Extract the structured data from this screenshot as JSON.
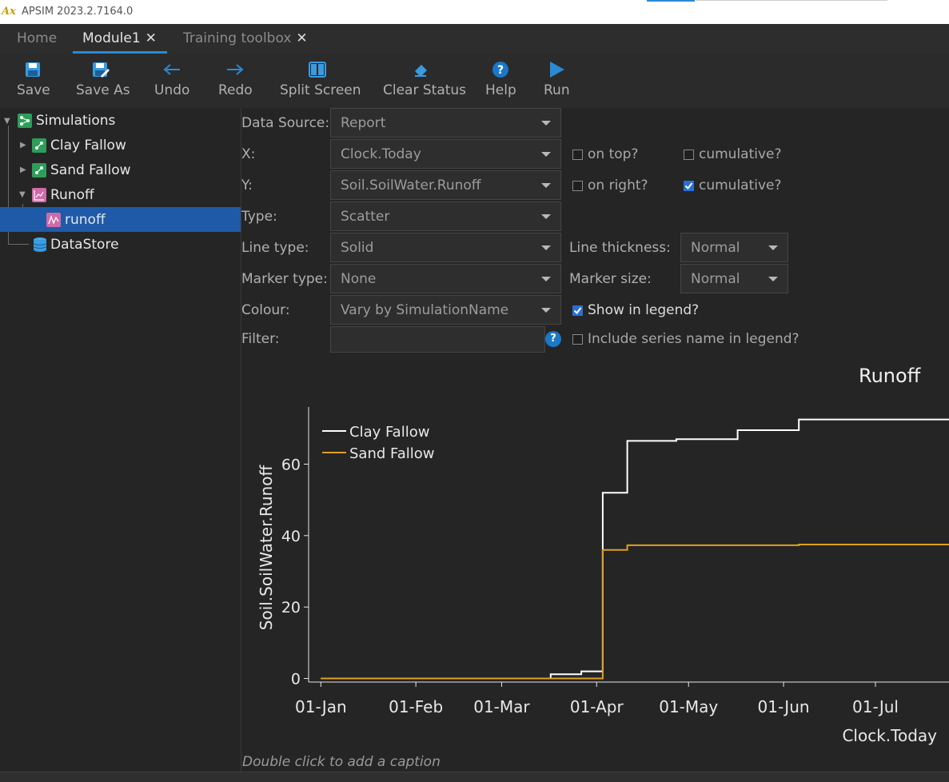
{
  "app": {
    "title": "APSIM 2023.2.7164.0",
    "logo_letter": "A",
    "logo_sub": "x"
  },
  "tabs": [
    {
      "label": "Home"
    },
    {
      "label": "Module1",
      "active": true
    },
    {
      "label": "Training toolbox"
    }
  ],
  "tab_close_glyph": "✕",
  "toolbar": [
    {
      "label": "Save",
      "icon": "save-icon"
    },
    {
      "label": "Save As",
      "icon": "save-as-icon"
    },
    {
      "label": "Undo",
      "icon": "undo-arrow-icon"
    },
    {
      "label": "Redo",
      "icon": "redo-arrow-icon"
    },
    {
      "label": "Split Screen",
      "icon": "split-screen-icon"
    },
    {
      "label": "Clear Status",
      "icon": "eraser-icon"
    },
    {
      "label": "Help",
      "icon": "help-icon"
    },
    {
      "label": "Run",
      "icon": "run-play-icon"
    }
  ],
  "tree": [
    {
      "label": "Simulations",
      "icon": "simulations-icon",
      "expanded": true
    },
    {
      "label": "Clay Fallow",
      "icon": "simulation-icon",
      "expanded": false
    },
    {
      "label": "Sand Fallow",
      "icon": "simulation-icon",
      "expanded": false
    },
    {
      "label": "Runoff",
      "icon": "graph-icon",
      "expanded": true
    },
    {
      "label": "runoff",
      "icon": "series-icon",
      "selected": true
    },
    {
      "label": "DataStore",
      "icon": "datastore-icon"
    }
  ],
  "form": {
    "data_source_label": "Data Source:",
    "data_source": "Report",
    "x_label": "X:",
    "x_value": "Clock.Today",
    "y_label": "Y:",
    "y_value": "Soil.SoilWater.Runoff",
    "type_label": "Type:",
    "type_value": "Scatter",
    "line_type_label": "Line type:",
    "line_type": "Solid",
    "marker_type_label": "Marker type:",
    "marker_type": "None",
    "colour_label": "Colour:",
    "colour": "Vary by SimulationName",
    "filter_label": "Filter:",
    "filter_value": "",
    "line_thickness_label": "Line thickness:",
    "line_thickness": "Normal",
    "marker_size_label": "Marker size:",
    "marker_size": "Normal",
    "on_top_label": "on top?",
    "on_top": false,
    "x_cumulative_label": "cumulative?",
    "x_cumulative": false,
    "on_right_label": "on right?",
    "on_right": false,
    "y_cumulative_label": "cumulative?",
    "y_cumulative": true,
    "show_legend_label": "Show in legend?",
    "show_legend": true,
    "include_series_label": "Include series name in legend?",
    "include_series": false,
    "help_glyph": "?"
  },
  "caption": "Double click to add a caption",
  "colors": {
    "accent": "#2a8ad4",
    "selection": "#1e5aa8",
    "clay": "#ffffff",
    "sand": "#e0a020"
  },
  "chart_data": {
    "type": "line",
    "title": "Runoff",
    "xlabel": "Clock.Today",
    "ylabel": "Soil.SoilWater.Runoff",
    "x_tick_labels": [
      "01-Jan",
      "01-Feb",
      "01-Mar",
      "01-Apr",
      "01-May",
      "01-Jun",
      "01-Jul"
    ],
    "x_ticks_day": [
      0,
      31,
      59,
      90,
      120,
      151,
      181
    ],
    "y_ticks": [
      0,
      20,
      40,
      60
    ],
    "ylim": [
      -1,
      76
    ],
    "xlim_day": [
      -4,
      205
    ],
    "legend_position": "top-left",
    "series": [
      {
        "name": "Clay Fallow",
        "color": "#ffffff",
        "step": true,
        "points": [
          [
            0,
            0
          ],
          [
            75,
            0
          ],
          [
            75,
            1.2
          ],
          [
            85,
            1.2
          ],
          [
            85,
            2
          ],
          [
            92,
            2
          ],
          [
            92,
            52
          ],
          [
            100,
            52
          ],
          [
            100,
            66.5
          ],
          [
            116,
            66.5
          ],
          [
            116,
            67
          ],
          [
            136,
            67
          ],
          [
            136,
            69.5
          ],
          [
            156,
            69.5
          ],
          [
            156,
            72.5
          ],
          [
            205,
            72.5
          ]
        ]
      },
      {
        "name": "Sand Fallow",
        "color": "#e0a020",
        "step": true,
        "points": [
          [
            0,
            0
          ],
          [
            92,
            0
          ],
          [
            92,
            36
          ],
          [
            100,
            36
          ],
          [
            100,
            37.3
          ],
          [
            156,
            37.3
          ],
          [
            156,
            37.5
          ],
          [
            205,
            37.5
          ]
        ]
      }
    ]
  }
}
